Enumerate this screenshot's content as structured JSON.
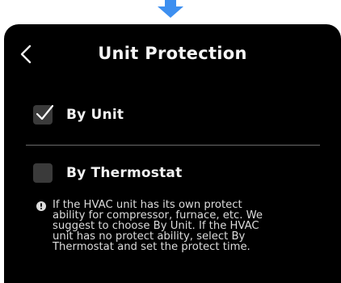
{
  "header": {
    "title": "Unit Protection"
  },
  "options": [
    {
      "label": "By Unit",
      "checked": true
    },
    {
      "label": "By Thermostat",
      "checked": false
    }
  ],
  "note": {
    "text": "If the HVAC unit has its own protect\nability for compressor, furnace, etc. We\nsuggest to choose By Unit. If the HVAC\nunit has no protect ability, select By\nThermostat and set the protect time."
  },
  "colors": {
    "arrow": "#3d8ff0",
    "panel_background": "#000000",
    "checkbox": "#3a3a3a"
  },
  "icons": {
    "top": "arrow-down-icon",
    "back": "chevron-left-icon",
    "check": "checkmark-icon",
    "info": "info-circle-icon"
  }
}
